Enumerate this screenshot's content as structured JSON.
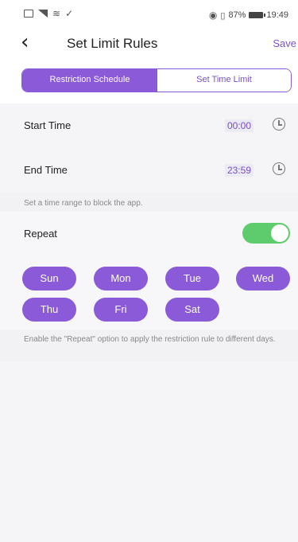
{
  "status_bar": {
    "left_icons": [
      "sim-icon",
      "signal-icon",
      "wifi-icon",
      "check-icon"
    ],
    "battery_text": "87%",
    "time": "19:49"
  },
  "header": {
    "back_icon": "chevron-left-icon",
    "back_glyph": "‹",
    "title": "Set Limit Rules",
    "save_label": "Save"
  },
  "tabs": [
    {
      "label": "Restriction Schedule",
      "active": true
    },
    {
      "label": "Set Time Limit",
      "active": false
    }
  ],
  "schedule": {
    "start_label": "Start Time",
    "start_value": "00:00",
    "end_label": "End Time",
    "end_value": "23:59",
    "hint": "Set a time range to block the app."
  },
  "repeat": {
    "label": "Repeat",
    "enabled": true,
    "days": [
      "Sun",
      "Mon",
      "Tue",
      "Wed",
      "Thu",
      "Fri",
      "Sat"
    ],
    "hint": "Enable the \"Repeat\" option to apply the restriction rule to different days."
  },
  "colors": {
    "accent": "#8a5ad8",
    "toggle_on": "#5ecb6d",
    "background": "#f2f2f5"
  }
}
